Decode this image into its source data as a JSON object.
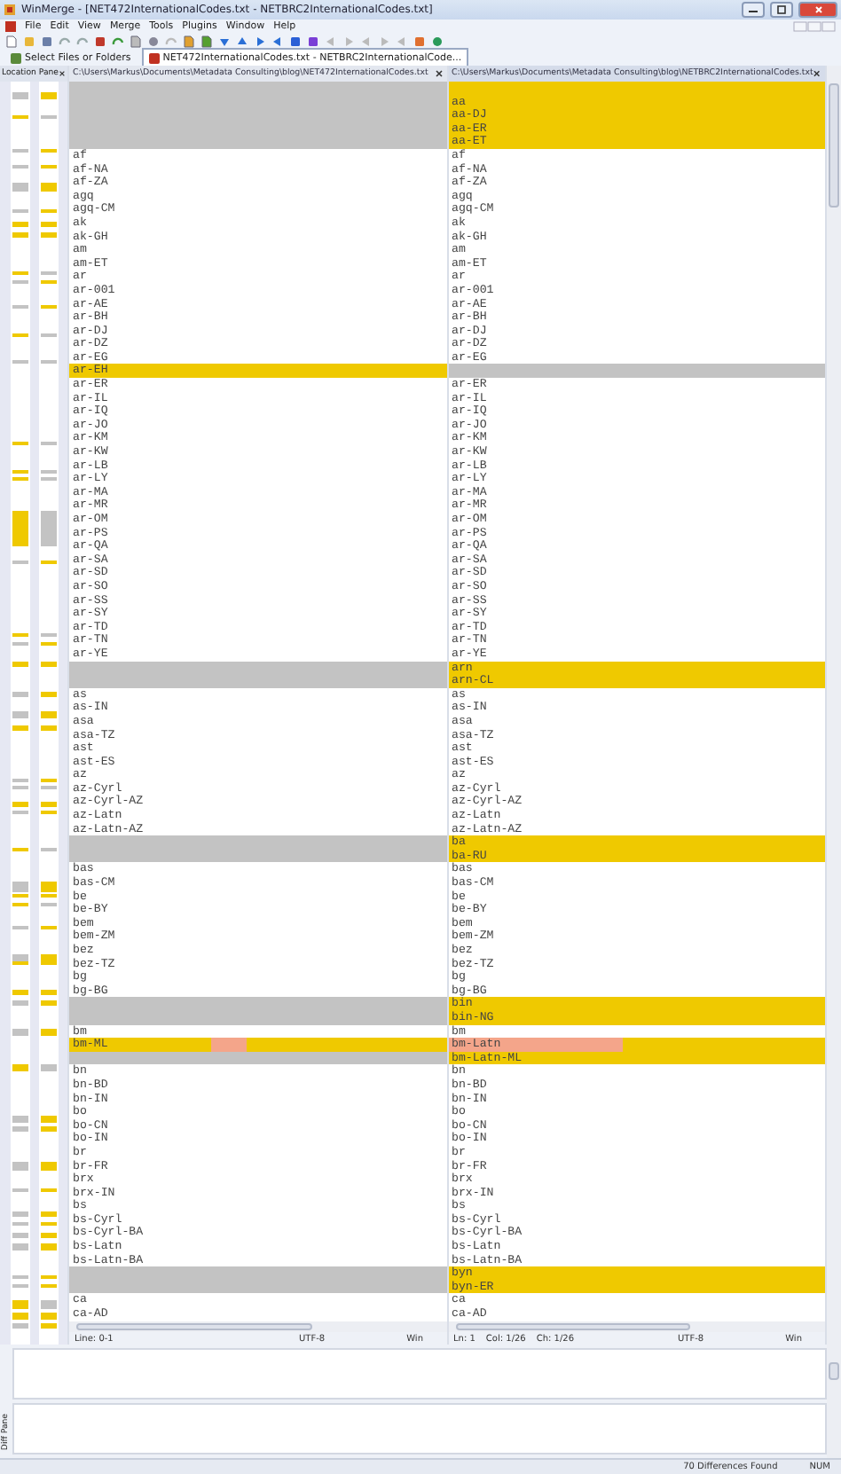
{
  "window": {
    "title": "WinMerge - [NET472InternationalCodes.txt - NETBRC2InternationalCodes.txt]"
  },
  "menu": [
    "File",
    "Edit",
    "View",
    "Merge",
    "Tools",
    "Plugins",
    "Window",
    "Help"
  ],
  "tabs": [
    {
      "label": "Select Files or Folders",
      "selected": false
    },
    {
      "label": "NET472InternationalCodes.txt - NETBRC2InternationalCode...",
      "selected": true
    }
  ],
  "location_pane": {
    "title": "Location Pane"
  },
  "left_pane": {
    "path": "C:\\Users\\Markus\\Documents\\Metadata Consulting\\blog\\NET472InternationalCodes.txt"
  },
  "right_pane": {
    "path": "C:\\Users\\Markus\\Documents\\Metadata Consulting\\blog\\NETBRC2InternationalCodes.txt"
  },
  "rows": [
    {
      "kind": "added"
    },
    {
      "kind": "added",
      "right": "aa"
    },
    {
      "kind": "added",
      "right": "aa-DJ"
    },
    {
      "kind": "added",
      "right": "aa-ER"
    },
    {
      "kind": "added",
      "right": "aa-ET"
    },
    {
      "kind": "same",
      "left": "af",
      "right": "af"
    },
    {
      "kind": "same",
      "left": "af-NA",
      "right": "af-NA"
    },
    {
      "kind": "same",
      "left": "af-ZA",
      "right": "af-ZA"
    },
    {
      "kind": "same",
      "left": "agq",
      "right": "agq"
    },
    {
      "kind": "same",
      "left": "agq-CM",
      "right": "agq-CM"
    },
    {
      "kind": "same",
      "left": "ak",
      "right": "ak"
    },
    {
      "kind": "same",
      "left": "ak-GH",
      "right": "ak-GH"
    },
    {
      "kind": "same",
      "left": "am",
      "right": "am"
    },
    {
      "kind": "same",
      "left": "am-ET",
      "right": "am-ET"
    },
    {
      "kind": "same",
      "left": "ar",
      "right": "ar"
    },
    {
      "kind": "same",
      "left": "ar-001",
      "right": "ar-001"
    },
    {
      "kind": "same",
      "left": "ar-AE",
      "right": "ar-AE"
    },
    {
      "kind": "same",
      "left": "ar-BH",
      "right": "ar-BH"
    },
    {
      "kind": "same",
      "left": "ar-DJ",
      "right": "ar-DJ"
    },
    {
      "kind": "same",
      "left": "ar-DZ",
      "right": "ar-DZ"
    },
    {
      "kind": "same",
      "left": "ar-EG",
      "right": "ar-EG"
    },
    {
      "kind": "removed",
      "left": "ar-EH"
    },
    {
      "kind": "same",
      "left": "ar-ER",
      "right": "ar-ER"
    },
    {
      "kind": "same",
      "left": "ar-IL",
      "right": "ar-IL"
    },
    {
      "kind": "same",
      "left": "ar-IQ",
      "right": "ar-IQ"
    },
    {
      "kind": "same",
      "left": "ar-JO",
      "right": "ar-JO"
    },
    {
      "kind": "same",
      "left": "ar-KM",
      "right": "ar-KM"
    },
    {
      "kind": "same",
      "left": "ar-KW",
      "right": "ar-KW"
    },
    {
      "kind": "same",
      "left": "ar-LB",
      "right": "ar-LB"
    },
    {
      "kind": "same",
      "left": "ar-LY",
      "right": "ar-LY"
    },
    {
      "kind": "same",
      "left": "ar-MA",
      "right": "ar-MA"
    },
    {
      "kind": "same",
      "left": "ar-MR",
      "right": "ar-MR"
    },
    {
      "kind": "same",
      "left": "ar-OM",
      "right": "ar-OM"
    },
    {
      "kind": "same",
      "left": "ar-PS",
      "right": "ar-PS"
    },
    {
      "kind": "same",
      "left": "ar-QA",
      "right": "ar-QA"
    },
    {
      "kind": "same",
      "left": "ar-SA",
      "right": "ar-SA"
    },
    {
      "kind": "same",
      "left": "ar-SD",
      "right": "ar-SD"
    },
    {
      "kind": "same",
      "left": "ar-SO",
      "right": "ar-SO"
    },
    {
      "kind": "same",
      "left": "ar-SS",
      "right": "ar-SS"
    },
    {
      "kind": "same",
      "left": "ar-SY",
      "right": "ar-SY"
    },
    {
      "kind": "same",
      "left": "ar-TD",
      "right": "ar-TD"
    },
    {
      "kind": "same",
      "left": "ar-TN",
      "right": "ar-TN"
    },
    {
      "kind": "same",
      "left": "ar-YE",
      "right": "ar-YE"
    },
    {
      "kind": "added",
      "right": "arn"
    },
    {
      "kind": "added",
      "right": "arn-CL"
    },
    {
      "kind": "same",
      "left": "as",
      "right": "as"
    },
    {
      "kind": "same",
      "left": "as-IN",
      "right": "as-IN"
    },
    {
      "kind": "same",
      "left": "asa",
      "right": "asa"
    },
    {
      "kind": "same",
      "left": "asa-TZ",
      "right": "asa-TZ"
    },
    {
      "kind": "same",
      "left": "ast",
      "right": "ast"
    },
    {
      "kind": "same",
      "left": "ast-ES",
      "right": "ast-ES"
    },
    {
      "kind": "same",
      "left": "az",
      "right": "az"
    },
    {
      "kind": "same",
      "left": "az-Cyrl",
      "right": "az-Cyrl"
    },
    {
      "kind": "same",
      "left": "az-Cyrl-AZ",
      "right": "az-Cyrl-AZ"
    },
    {
      "kind": "same",
      "left": "az-Latn",
      "right": "az-Latn"
    },
    {
      "kind": "same",
      "left": "az-Latn-AZ",
      "right": "az-Latn-AZ"
    },
    {
      "kind": "added",
      "right": "ba"
    },
    {
      "kind": "added",
      "right": "ba-RU"
    },
    {
      "kind": "same",
      "left": "bas",
      "right": "bas"
    },
    {
      "kind": "same",
      "left": "bas-CM",
      "right": "bas-CM"
    },
    {
      "kind": "same",
      "left": "be",
      "right": "be"
    },
    {
      "kind": "same",
      "left": "be-BY",
      "right": "be-BY"
    },
    {
      "kind": "same",
      "left": "bem",
      "right": "bem"
    },
    {
      "kind": "same",
      "left": "bem-ZM",
      "right": "bem-ZM"
    },
    {
      "kind": "same",
      "left": "bez",
      "right": "bez"
    },
    {
      "kind": "same",
      "left": "bez-TZ",
      "right": "bez-TZ"
    },
    {
      "kind": "same",
      "left": "bg",
      "right": "bg"
    },
    {
      "kind": "same",
      "left": "bg-BG",
      "right": "bg-BG"
    },
    {
      "kind": "added",
      "right": "bin"
    },
    {
      "kind": "added",
      "right": "bin-NG"
    },
    {
      "kind": "same",
      "left": "bm",
      "right": "bm"
    },
    {
      "kind": "changed",
      "left": "bm-ML",
      "right": "bm-Latn"
    },
    {
      "kind": "added",
      "right": "bm-Latn-ML"
    },
    {
      "kind": "same",
      "left": "bn",
      "right": "bn"
    },
    {
      "kind": "same",
      "left": "bn-BD",
      "right": "bn-BD"
    },
    {
      "kind": "same",
      "left": "bn-IN",
      "right": "bn-IN"
    },
    {
      "kind": "same",
      "left": "bo",
      "right": "bo"
    },
    {
      "kind": "same",
      "left": "bo-CN",
      "right": "bo-CN"
    },
    {
      "kind": "same",
      "left": "bo-IN",
      "right": "bo-IN"
    },
    {
      "kind": "same",
      "left": "br",
      "right": "br"
    },
    {
      "kind": "same",
      "left": "br-FR",
      "right": "br-FR"
    },
    {
      "kind": "same",
      "left": "brx",
      "right": "brx"
    },
    {
      "kind": "same",
      "left": "brx-IN",
      "right": "brx-IN"
    },
    {
      "kind": "same",
      "left": "bs",
      "right": "bs"
    },
    {
      "kind": "same",
      "left": "bs-Cyrl",
      "right": "bs-Cyrl"
    },
    {
      "kind": "same",
      "left": "bs-Cyrl-BA",
      "right": "bs-Cyrl-BA"
    },
    {
      "kind": "same",
      "left": "bs-Latn",
      "right": "bs-Latn"
    },
    {
      "kind": "same",
      "left": "bs-Latn-BA",
      "right": "bs-Latn-BA"
    },
    {
      "kind": "added",
      "right": "byn"
    },
    {
      "kind": "added",
      "right": "byn-ER"
    },
    {
      "kind": "same",
      "left": "ca",
      "right": "ca"
    },
    {
      "kind": "same",
      "left": "ca-AD",
      "right": "ca-AD"
    }
  ],
  "left_status": {
    "position": [
      "Line: 0-1"
    ],
    "encoding": "UTF-8",
    "eol": "Win"
  },
  "right_status": {
    "position": [
      "Ln: 1",
      "Col: 1/26",
      "Ch: 1/26"
    ],
    "encoding": "UTF-8",
    "eol": "Win"
  },
  "diff_pane": {
    "title": "Diff Pane"
  },
  "status_bar": {
    "message": "70 Differences Found",
    "num": "NUM"
  }
}
